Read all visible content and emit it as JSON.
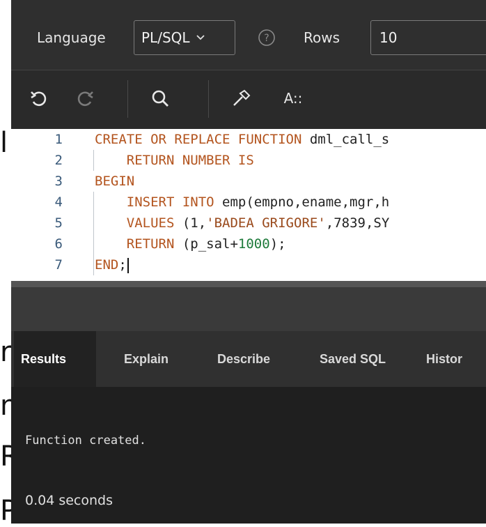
{
  "background_fragments": [
    "l",
    "r",
    "n",
    "R",
    "P"
  ],
  "header": {
    "language_label": "Language",
    "language_value": "PL/SQL",
    "rows_label": "Rows",
    "rows_value": "10"
  },
  "toolbar": {
    "undo_icon": "undo-icon",
    "redo_icon": "redo-icon",
    "search_icon": "search-icon",
    "hammer_icon": "hammer-icon",
    "format_label": "A::"
  },
  "editor": {
    "lines": [
      {
        "number": "1",
        "tokens": [
          {
            "t": "CREATE OR REPLACE FUNCTION ",
            "c": "kw"
          },
          {
            "t": "dml_call_s",
            "c": "id"
          }
        ]
      },
      {
        "number": "2",
        "tokens": [
          {
            "t": "    RETURN NUMBER IS",
            "c": "kw"
          }
        ]
      },
      {
        "number": "3",
        "tokens": [
          {
            "t": "BEGIN",
            "c": "kw"
          }
        ]
      },
      {
        "number": "4",
        "tokens": [
          {
            "t": "    INSERT INTO ",
            "c": "kw"
          },
          {
            "t": "emp(empno,ename,mgr,h",
            "c": "id"
          }
        ]
      },
      {
        "number": "5",
        "tokens": [
          {
            "t": "    VALUES ",
            "c": "kw"
          },
          {
            "t": "(1,",
            "c": "id"
          },
          {
            "t": "'BADEA GRIGORE'",
            "c": "str"
          },
          {
            "t": ",7839,SY",
            "c": "id"
          }
        ]
      },
      {
        "number": "6",
        "tokens": [
          {
            "t": "    RETURN ",
            "c": "kw"
          },
          {
            "t": "(p_sal+",
            "c": "id"
          },
          {
            "t": "1000",
            "c": "num"
          },
          {
            "t": ");",
            "c": "id"
          }
        ]
      },
      {
        "number": "7",
        "tokens": [
          {
            "t": "END",
            "c": "kw"
          },
          {
            "t": ";",
            "c": "id"
          }
        ]
      }
    ]
  },
  "tabs": [
    "Results",
    "Explain",
    "Describe",
    "Saved SQL",
    "Histor"
  ],
  "results": {
    "message": "Function created.",
    "elapsed": "0.04 seconds"
  },
  "colors": {
    "keyword": "#b3541e",
    "string": "#9a4a1c",
    "number": "#1d7a3a",
    "panel_bg": "#262626"
  }
}
